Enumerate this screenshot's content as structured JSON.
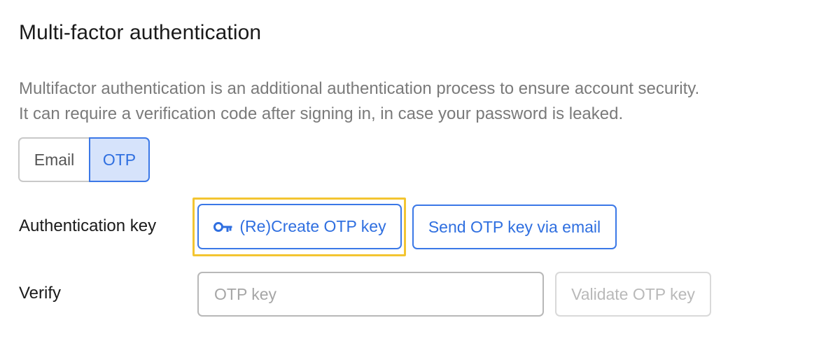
{
  "section": {
    "title": "Multi-factor authentication",
    "description_line1": "Multifactor authentication is an additional authentication process to ensure account security.",
    "description_line2": "It can require a verification code after signing in, in case your password is leaked."
  },
  "method_toggle": {
    "email_label": "Email",
    "otp_label": "OTP",
    "selected": "OTP"
  },
  "auth_key": {
    "label": "Authentication key",
    "create_button_label": "(Re)Create OTP key",
    "create_button_icon": "key-icon",
    "send_button_label": "Send OTP key via email"
  },
  "verify": {
    "label": "Verify",
    "input_value": "",
    "input_placeholder": "OTP key",
    "validate_button_label": "Validate OTP key"
  },
  "colors": {
    "accent": "#3b78e7",
    "accent_bg": "#d6e3fb",
    "focus_ring": "#f3c531",
    "disabled": "#b9b9b9"
  }
}
